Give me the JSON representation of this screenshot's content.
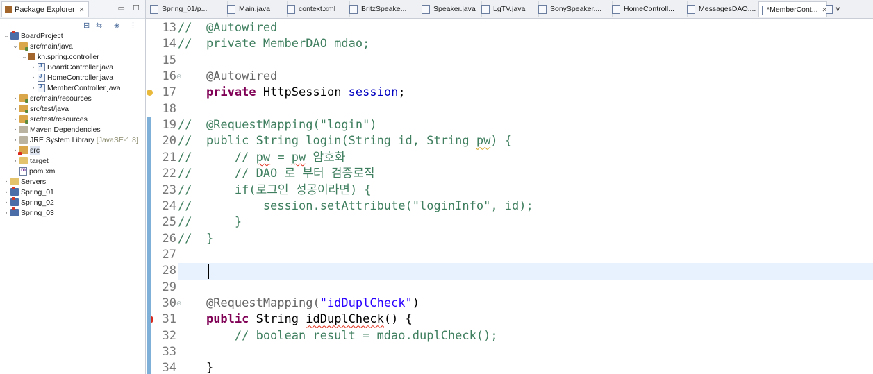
{
  "explorer": {
    "title": "Package Explorer",
    "tree": [
      {
        "label": "BoardProject",
        "type": "project",
        "depth": 0,
        "expanded": true
      },
      {
        "label": "src/main/java",
        "type": "srcfolder",
        "depth": 1,
        "expanded": true
      },
      {
        "label": "kh.spring.controller",
        "type": "pkg",
        "depth": 2,
        "expanded": true
      },
      {
        "label": "BoardController.java",
        "type": "javafile",
        "depth": 3,
        "expanded": false
      },
      {
        "label": "HomeController.java",
        "type": "javafile",
        "depth": 3,
        "expanded": false
      },
      {
        "label": "MemberController.java",
        "type": "javafile",
        "depth": 3,
        "expanded": false
      },
      {
        "label": "src/main/resources",
        "type": "srcfolder",
        "depth": 1,
        "expanded": false
      },
      {
        "label": "src/test/java",
        "type": "srcfolder",
        "depth": 1,
        "expanded": false
      },
      {
        "label": "src/test/resources",
        "type": "srcfolder",
        "depth": 1,
        "expanded": false
      },
      {
        "label": "Maven Dependencies",
        "type": "lib",
        "depth": 1,
        "expanded": false
      },
      {
        "label": "JRE System Library",
        "extra": "[JavaSE-1.8]",
        "type": "lib",
        "depth": 1,
        "expanded": false
      },
      {
        "label": "src",
        "type": "src-err",
        "depth": 1,
        "expanded": false,
        "selected": true
      },
      {
        "label": "target",
        "type": "folder",
        "depth": 1,
        "expanded": false
      },
      {
        "label": "pom.xml",
        "type": "xml",
        "depth": 1,
        "expanded": null
      },
      {
        "label": "Servers",
        "type": "folder",
        "depth": 0,
        "expanded": false
      },
      {
        "label": "Spring_01",
        "type": "project",
        "depth": 0,
        "expanded": false
      },
      {
        "label": "Spring_02",
        "type": "project",
        "depth": 0,
        "expanded": false
      },
      {
        "label": "Spring_03",
        "type": "project",
        "depth": 0,
        "expanded": false
      }
    ]
  },
  "tabs": [
    {
      "label": "Spring_01/p...",
      "active": false
    },
    {
      "label": "Main.java",
      "active": false
    },
    {
      "label": "context.xml",
      "active": false
    },
    {
      "label": "BritzSpeake...",
      "active": false
    },
    {
      "label": "Speaker.java",
      "active": false
    },
    {
      "label": "LgTV.java",
      "active": false
    },
    {
      "label": "SonySpeaker....",
      "active": false
    },
    {
      "label": "HomeControll...",
      "active": false
    },
    {
      "label": "MessagesDAO....",
      "active": false
    },
    {
      "label": "*MemberCont...",
      "active": true
    },
    {
      "label": "v",
      "active": false
    }
  ],
  "editor": {
    "current_line": 28,
    "lines": [
      {
        "n": "13",
        "segments": [
          {
            "t": "//  @Autowired",
            "c": "cmt"
          }
        ]
      },
      {
        "n": "14",
        "segments": [
          {
            "t": "//  private MemberDAO mdao;",
            "c": "cmt"
          }
        ]
      },
      {
        "n": "15",
        "segments": []
      },
      {
        "n": "16",
        "fold": "⊖",
        "segments": [
          {
            "t": "    @Autowired",
            "c": "ann"
          }
        ]
      },
      {
        "n": "17",
        "marker": "warn",
        "segments": [
          {
            "t": "    ",
            "c": ""
          },
          {
            "t": "private",
            "c": "kw"
          },
          {
            "t": " HttpSession ",
            "c": ""
          },
          {
            "t": "session",
            "c": "fld"
          },
          {
            "t": ";",
            "c": ""
          }
        ]
      },
      {
        "n": "18",
        "segments": []
      },
      {
        "n": "19",
        "segments": [
          {
            "t": "//  @RequestMapping(\"login\")",
            "c": "cmt"
          }
        ]
      },
      {
        "n": "20",
        "segments": [
          {
            "t": "//  public String login(String id, String ",
            "c": "cmt"
          },
          {
            "t": "pw",
            "c": "cmt squig"
          },
          {
            "t": ") {",
            "c": "cmt"
          }
        ]
      },
      {
        "n": "21",
        "segments": [
          {
            "t": "//      // ",
            "c": "cmt"
          },
          {
            "t": "pw",
            "c": "cmt squig-red"
          },
          {
            "t": " = ",
            "c": "cmt"
          },
          {
            "t": "pw",
            "c": "cmt squig-red"
          },
          {
            "t": " 암호화",
            "c": "cmt"
          }
        ]
      },
      {
        "n": "22",
        "segments": [
          {
            "t": "//      // DAO 로 부터 검증로직",
            "c": "cmt"
          }
        ]
      },
      {
        "n": "23",
        "segments": [
          {
            "t": "//      if(로그인 성공이라면) {",
            "c": "cmt"
          }
        ]
      },
      {
        "n": "24",
        "segments": [
          {
            "t": "//          session.setAttribute(\"loginInfo\", id);",
            "c": "cmt"
          }
        ]
      },
      {
        "n": "25",
        "segments": [
          {
            "t": "//      }",
            "c": "cmt"
          }
        ]
      },
      {
        "n": "26",
        "segments": [
          {
            "t": "//  }",
            "c": "cmt"
          }
        ]
      },
      {
        "n": "27",
        "segments": []
      },
      {
        "n": "28",
        "current": true,
        "segments": []
      },
      {
        "n": "29",
        "segments": []
      },
      {
        "n": "30",
        "fold": "⊖",
        "segments": [
          {
            "t": "    @RequestMapping(",
            "c": "ann"
          },
          {
            "t": "\"idDuplCheck\"",
            "c": "str"
          },
          {
            "t": ")",
            "c": ""
          }
        ]
      },
      {
        "n": "31",
        "marker": "err",
        "segments": [
          {
            "t": "    ",
            "c": ""
          },
          {
            "t": "public",
            "c": "kw"
          },
          {
            "t": " String ",
            "c": ""
          },
          {
            "t": "idDuplCheck",
            "c": "squig-red"
          },
          {
            "t": "() {",
            "c": ""
          }
        ]
      },
      {
        "n": "32",
        "segments": [
          {
            "t": "        // boolean result = mdao.duplCheck();",
            "c": "cmt"
          }
        ]
      },
      {
        "n": "33",
        "segments": []
      },
      {
        "n": "34",
        "segments": [
          {
            "t": "    }",
            "c": ""
          }
        ]
      }
    ]
  }
}
